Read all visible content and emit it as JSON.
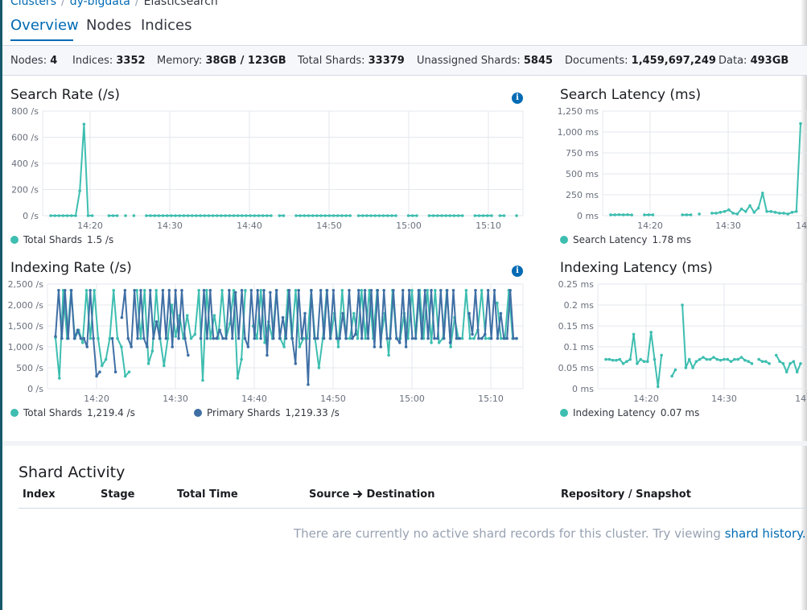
{
  "breadcrumb": {
    "clusters": "Clusters",
    "cluster": "dy-bigdata",
    "current": "Elasticsearch",
    "separator": "/"
  },
  "tabs": [
    {
      "label": "Overview",
      "active": true
    },
    {
      "label": "Nodes",
      "active": false
    },
    {
      "label": "Indices",
      "active": false
    }
  ],
  "summary": {
    "nodes": {
      "label": "Nodes:",
      "value": "4"
    },
    "indices": {
      "label": "Indices:",
      "value": "3352"
    },
    "memory": {
      "label": "Memory:",
      "value": "38GB / 123GB"
    },
    "total_shards": {
      "label": "Total Shards:",
      "value": "33379"
    },
    "unassigned_shards": {
      "label": "Unassigned Shards:",
      "value": "5845"
    },
    "documents": {
      "label": "Documents:",
      "value": "1,459,697,249"
    },
    "data": {
      "label": "Data:",
      "value": "493GB"
    }
  },
  "colors": {
    "teal": "#3ebeb0",
    "blue": "#3f6fa5",
    "link": "#006bb4"
  },
  "info_icon": "info-icon",
  "charts": {
    "search_rate": {
      "title": "Search Rate (/s)",
      "legend": [
        {
          "name": "Total Shards",
          "value": "1.5 /s",
          "color": "#3ebeb0"
        }
      ]
    },
    "search_latency": {
      "title": "Search Latency (ms)",
      "legend": [
        {
          "name": "Search Latency",
          "value": "1.78 ms",
          "color": "#3ebeb0"
        }
      ]
    },
    "indexing_rate": {
      "title": "Indexing Rate (/s)",
      "legend": [
        {
          "name": "Total Shards",
          "value": "1,219.4 /s",
          "color": "#3ebeb0"
        },
        {
          "name": "Primary Shards",
          "value": "1,219.33 /s",
          "color": "#3f6fa5"
        }
      ]
    },
    "indexing_latency": {
      "title": "Indexing Latency (ms)",
      "legend": [
        {
          "name": "Indexing Latency",
          "value": "0.07 ms",
          "color": "#3ebeb0"
        }
      ]
    }
  },
  "chart_data": [
    {
      "type": "line",
      "title": "Search Rate (/s)",
      "x_ticks": [
        "14:20",
        "14:30",
        "14:40",
        "14:50",
        "15:00",
        "15:10"
      ],
      "y_ticks": [
        "0 /s",
        "200 /s",
        "400 /s",
        "600 /s",
        "800 /s"
      ],
      "ylim": [
        0,
        800
      ],
      "series": [
        {
          "name": "Total Shards",
          "color": "#3ebeb0",
          "values": [
            0,
            0,
            0,
            0,
            0,
            0,
            0,
            190,
            700,
            0,
            0,
            null,
            null,
            null,
            0,
            0,
            0,
            null,
            0,
            null,
            0,
            null,
            null,
            0,
            0,
            0,
            0,
            0,
            0,
            0,
            0,
            0,
            0,
            0,
            0,
            0,
            0,
            0,
            0,
            0,
            0,
            0,
            0,
            0,
            0,
            0,
            0,
            0,
            0,
            0,
            0,
            0,
            0,
            0,
            null,
            0,
            0,
            null,
            null,
            0,
            0,
            0,
            0,
            0,
            0,
            0,
            0,
            0,
            0,
            0,
            0,
            0,
            0,
            null,
            0,
            0,
            0,
            0,
            0,
            0,
            0,
            0,
            0,
            0,
            null,
            null,
            0,
            0,
            0,
            null,
            null,
            0,
            0,
            0,
            0,
            0,
            0,
            0,
            0,
            0,
            null,
            null,
            0,
            0,
            0,
            0,
            0,
            null,
            0,
            0,
            null,
            null,
            0
          ]
        }
      ]
    },
    {
      "type": "line",
      "title": "Search Latency (ms)",
      "x_ticks": [
        "14:20",
        "14:30",
        "14:"
      ],
      "y_ticks": [
        "0 ms",
        "250 ms",
        "500 ms",
        "750 ms",
        "1,000 ms",
        "1,250 ms"
      ],
      "ylim": [
        0,
        1250
      ],
      "series": [
        {
          "name": "Search Latency",
          "color": "#3ebeb0",
          "values": [
            10,
            10,
            12,
            10,
            12,
            8,
            null,
            null,
            10,
            10,
            10,
            null,
            null,
            null,
            null,
            null,
            null,
            10,
            10,
            10,
            null,
            20,
            null,
            null,
            30,
            30,
            40,
            50,
            70,
            30,
            20,
            80,
            50,
            120,
            40,
            90,
            270,
            50,
            50,
            40,
            30,
            30,
            20,
            40,
            50,
            1100
          ]
        }
      ]
    },
    {
      "type": "line",
      "title": "Indexing Rate (/s)",
      "x_ticks": [
        "14:20",
        "14:30",
        "14:40",
        "14:50",
        "15:00",
        "15:10"
      ],
      "y_ticks": [
        "0 /s",
        "500 /s",
        "1,000 /s",
        "1,500 /s",
        "2,000 /s",
        "2,500 /s"
      ],
      "ylim": [
        0,
        2500
      ],
      "series": [
        {
          "name": "Total Shards",
          "color": "#3ebeb0",
          "values": [
            1220,
            250,
            2350,
            1200,
            2350,
            1200,
            1400,
            1100,
            2350,
            1200,
            2350,
            1200,
            550,
            700,
            1200,
            2350,
            1200,
            1000,
            300,
            400,
            null,
            2350,
            1200,
            2350,
            600,
            900,
            2350,
            1200,
            550,
            1200,
            2000,
            1250,
            1750,
            1200,
            1750,
            1200,
            1300,
            2350,
            200,
            2350,
            1200,
            1750,
            1200,
            2350,
            1200,
            1550,
            2350,
            250,
            700,
            2350,
            null,
            1500,
            1200,
            2350,
            1100,
            1600,
            1200,
            2350,
            1200,
            1000,
            2350,
            1200,
            2350,
            1000,
            1200,
            1200,
            2350,
            1200,
            500,
            1200,
            2350,
            1200,
            1800,
            1000,
            2350,
            1200,
            1200,
            1800,
            1200,
            2350,
            1200,
            2350,
            1200,
            2350,
            1200,
            1800,
            800,
            2350,
            1200,
            1200,
            1800,
            1200,
            2350,
            1200,
            2350,
            1200,
            2350,
            1100,
            2350,
            1100,
            1200,
            2350,
            1000,
            1700,
            1200,
            1200,
            2350,
            1200,
            1200,
            1400,
            2350,
            1200,
            1200,
            null,
            2050,
            1200,
            1200,
            2350,
            1200,
            1200
          ]
        },
        {
          "name": "Primary Shards",
          "color": "#3f6fa5",
          "values": [
            1250,
            2350,
            1200,
            2350,
            1200,
            2350,
            1200,
            1400,
            1200,
            1200,
            1000,
            2350,
            1200,
            300,
            400,
            null,
            null,
            null,
            1200,
            400,
            null,
            1700,
            2350,
            1200,
            1000,
            2350,
            1200,
            2350,
            1200,
            1000,
            2350,
            1200,
            1600,
            1200,
            2350,
            1200,
            2350,
            1000,
            2350,
            1200,
            2350,
            1200,
            800,
            null,
            null,
            null,
            1200,
            2350,
            1200,
            2350,
            1200,
            1200,
            1400,
            1200,
            1200,
            2350,
            1200,
            2300,
            1200,
            2350,
            1200,
            1000,
            2350,
            1200,
            2350,
            1200,
            2350,
            800,
            2300,
            1200,
            2350,
            1200,
            1700,
            1200,
            2350,
            1200,
            600,
            2350,
            1200,
            1800,
            100,
            2350,
            1200,
            1200,
            2350,
            1200,
            2350,
            1200,
            2350,
            1200,
            1200,
            1800,
            1200,
            2350,
            1200,
            1300,
            2350,
            1200,
            2350,
            1200,
            2350,
            1000,
            2350,
            1000,
            2350,
            1200,
            1200,
            2350,
            1200,
            1100,
            2350,
            1000,
            2350,
            1200,
            1200,
            2350,
            1200,
            2350,
            1200,
            2350,
            1200,
            1200,
            2350,
            1200,
            2350,
            1100,
            2350,
            1200,
            1200,
            null,
            null,
            1800,
            1300,
            2350,
            1200,
            1200,
            1300,
            2350,
            1200,
            2350,
            1200,
            1800,
            1200,
            1200,
            2350,
            1200,
            1200
          ]
        }
      ]
    },
    {
      "type": "line",
      "title": "Indexing Latency (ms)",
      "x_ticks": [
        "14:20",
        "14:30",
        "14:"
      ],
      "y_ticks": [
        "0 ms",
        "0.05 ms",
        "0.1 ms",
        "0.15 ms",
        "0.2 ms",
        "0.25 ms"
      ],
      "ylim": [
        0,
        0.25
      ],
      "series": [
        {
          "name": "Indexing Latency",
          "color": "#3ebeb0",
          "values": [
            0.07,
            0.07,
            0.068,
            0.068,
            0.07,
            0.06,
            0.065,
            0.07,
            0.13,
            0.06,
            0.07,
            0.065,
            0.065,
            0.135,
            0.07,
            0.005,
            0.08,
            null,
            null,
            0.03,
            0.045,
            null,
            0.2,
            0.05,
            0.07,
            0.05,
            0.065,
            0.07,
            0.075,
            0.07,
            0.07,
            0.075,
            0.07,
            0.068,
            0.07,
            0.07,
            0.065,
            0.07,
            0.07,
            0.075,
            0.068,
            0.065,
            0.06,
            null,
            0.07,
            0.065,
            0.065,
            0.06,
            null,
            0.08,
            0.065,
            0.06,
            0.04,
            0.06,
            0.065,
            0.04,
            0.06
          ]
        }
      ]
    }
  ],
  "shard_activity": {
    "title": "Shard Activity",
    "columns": [
      "Index",
      "Stage",
      "Total Time",
      "Source",
      "Destination",
      "Repository / Snapshot"
    ],
    "arrow_icon": "arrow-right-icon",
    "empty_text": "There are currently no active shard records for this cluster. Try viewing",
    "empty_link": "shard history."
  }
}
